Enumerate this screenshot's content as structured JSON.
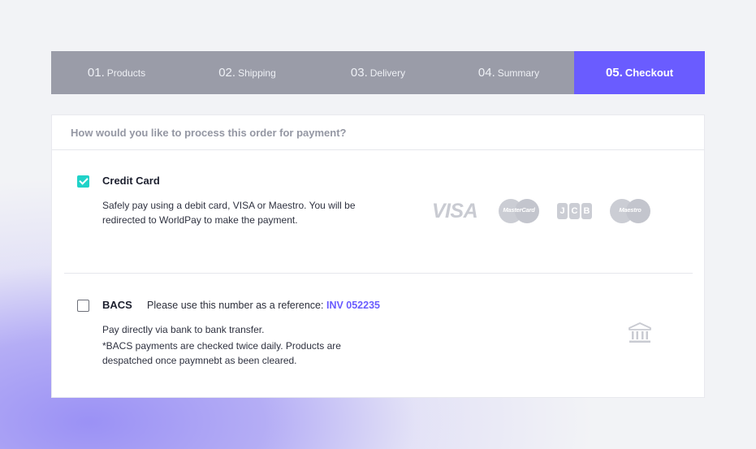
{
  "steps": [
    {
      "num": "01.",
      "label": "Products",
      "active": false
    },
    {
      "num": "02.",
      "label": "Shipping",
      "active": false
    },
    {
      "num": "03.",
      "label": "Delivery",
      "active": false
    },
    {
      "num": "04.",
      "label": "Summary",
      "active": false
    },
    {
      "num": "05.",
      "label": "Checkout",
      "active": true
    }
  ],
  "question": "How would you like to process this order for payment?",
  "credit_card": {
    "checked": true,
    "title": "Credit Card",
    "description": "Safely pay using a debit card, VISA or Maestro. You will be redirected to WorldPay to make the payment.",
    "logos": {
      "visa": "VISA",
      "mastercard": "MasterCard",
      "jcb": [
        "J",
        "C",
        "B"
      ],
      "maestro": "Maestro"
    }
  },
  "bacs": {
    "checked": false,
    "title": "BACS",
    "reference_label": "Please use this number as a reference: ",
    "reference_value": "INV 052235",
    "line1": "Pay directly via bank to bank transfer.",
    "line2": "*BACS payments are checked twice daily. Products are despatched once paymnebt as been cleared.",
    "icon": "bank-icon"
  },
  "colors": {
    "accent": "#6a5cff",
    "check": "#20d2c8",
    "stepper_bg": "#9a9ca8"
  }
}
